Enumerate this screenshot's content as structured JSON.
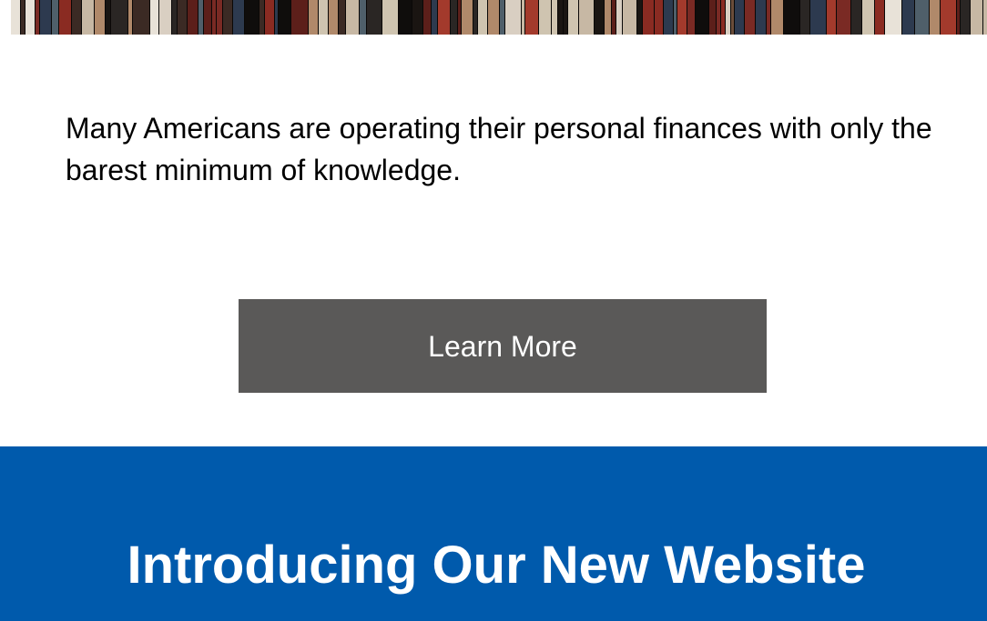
{
  "hero": {
    "image_subject": "bookshelf with books"
  },
  "content": {
    "body_text": "Many Americans are operating their personal finances with only the barest minimum of knowledge."
  },
  "cta": {
    "label": "Learn More",
    "background_color": "#5a5958",
    "text_color": "#ffffff"
  },
  "promo": {
    "heading": "Introducing Our New Website",
    "background_color": "#005aac",
    "text_color": "#ffffff"
  }
}
